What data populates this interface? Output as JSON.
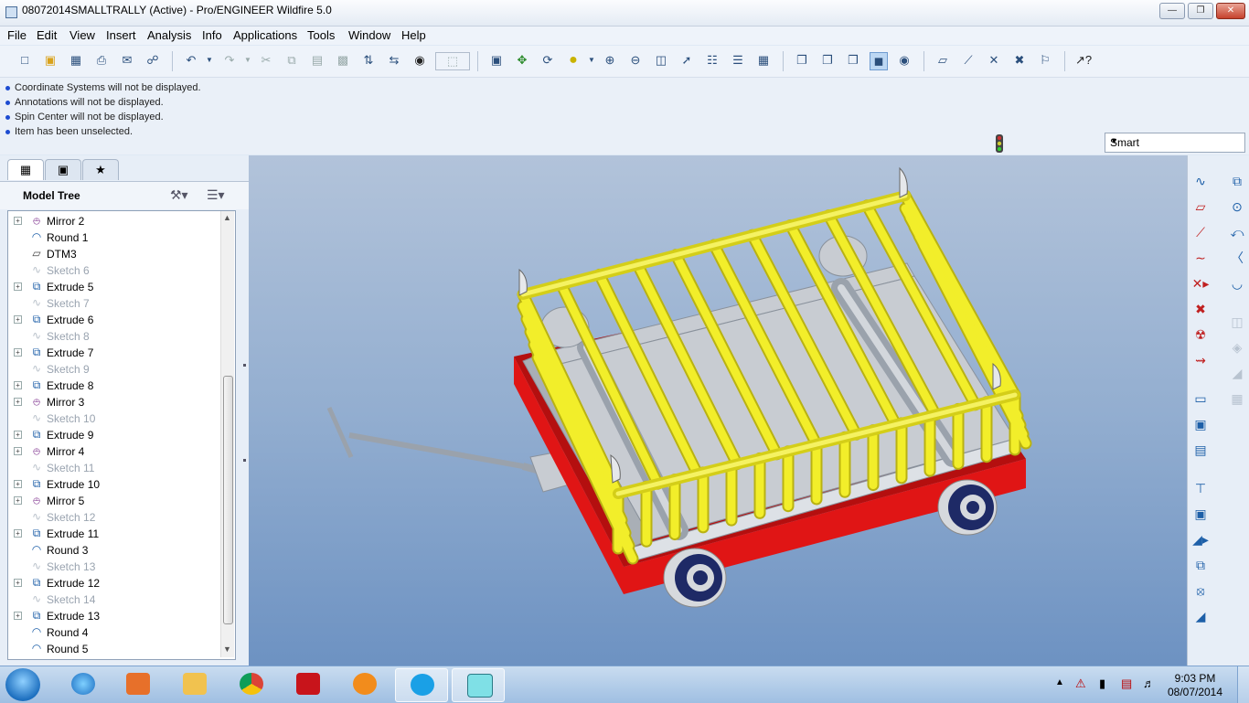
{
  "window": {
    "title": "08072014SMALLTRALLY (Active) - Pro/ENGINEER Wildfire 5.0"
  },
  "menubar": {
    "items": [
      "File",
      "Edit",
      "View",
      "Insert",
      "Analysis",
      "Info",
      "Applications",
      "Tools",
      "Window",
      "Help"
    ]
  },
  "messages": [
    "Coordinate Systems will not be displayed.",
    "Annotations will not be displayed.",
    "Spin Center will not be displayed.",
    "Item has been unselected."
  ],
  "filter": {
    "value": "Smart"
  },
  "model_tree": {
    "title": "Model Tree",
    "items": [
      {
        "label": "Mirror 2",
        "icon": "mirror-icon",
        "expandable": true,
        "sketch": false
      },
      {
        "label": "Round 1",
        "icon": "round-icon",
        "expandable": false,
        "sketch": false
      },
      {
        "label": "DTM3",
        "icon": "datum-plane-icon",
        "expandable": false,
        "sketch": false
      },
      {
        "label": "Sketch 6",
        "icon": "sketch-icon",
        "expandable": false,
        "sketch": true
      },
      {
        "label": "Extrude 5",
        "icon": "extrude-icon",
        "expandable": true,
        "sketch": false
      },
      {
        "label": "Sketch 7",
        "icon": "sketch-icon",
        "expandable": false,
        "sketch": true
      },
      {
        "label": "Extrude 6",
        "icon": "extrude-icon",
        "expandable": true,
        "sketch": false
      },
      {
        "label": "Sketch 8",
        "icon": "sketch-icon",
        "expandable": false,
        "sketch": true
      },
      {
        "label": "Extrude 7",
        "icon": "extrude-icon",
        "expandable": true,
        "sketch": false
      },
      {
        "label": "Sketch 9",
        "icon": "sketch-icon",
        "expandable": false,
        "sketch": true
      },
      {
        "label": "Extrude 8",
        "icon": "extrude-icon",
        "expandable": true,
        "sketch": false
      },
      {
        "label": "Mirror 3",
        "icon": "mirror-icon",
        "expandable": true,
        "sketch": false
      },
      {
        "label": "Sketch 10",
        "icon": "sketch-icon",
        "expandable": false,
        "sketch": true
      },
      {
        "label": "Extrude 9",
        "icon": "extrude-icon",
        "expandable": true,
        "sketch": false
      },
      {
        "label": "Mirror 4",
        "icon": "mirror-icon",
        "expandable": true,
        "sketch": false
      },
      {
        "label": "Sketch 11",
        "icon": "sketch-icon",
        "expandable": false,
        "sketch": true
      },
      {
        "label": "Extrude 10",
        "icon": "extrude-icon",
        "expandable": true,
        "sketch": false
      },
      {
        "label": "Mirror 5",
        "icon": "mirror-icon",
        "expandable": true,
        "sketch": false
      },
      {
        "label": "Sketch 12",
        "icon": "sketch-icon",
        "expandable": false,
        "sketch": true
      },
      {
        "label": "Extrude 11",
        "icon": "extrude-icon",
        "expandable": true,
        "sketch": false
      },
      {
        "label": "Round 3",
        "icon": "round-icon",
        "expandable": false,
        "sketch": false
      },
      {
        "label": "Sketch 13",
        "icon": "sketch-icon",
        "expandable": false,
        "sketch": true
      },
      {
        "label": "Extrude 12",
        "icon": "extrude-icon",
        "expandable": true,
        "sketch": false
      },
      {
        "label": "Sketch 14",
        "icon": "sketch-icon",
        "expandable": false,
        "sketch": true
      },
      {
        "label": "Extrude 13",
        "icon": "extrude-icon",
        "expandable": true,
        "sketch": false
      },
      {
        "label": "Round 4",
        "icon": "round-icon",
        "expandable": false,
        "sketch": false
      },
      {
        "label": "Round 5",
        "icon": "round-icon",
        "expandable": false,
        "sketch": false
      }
    ]
  },
  "colors": {
    "cart_yellow": "#f2ee2a",
    "cart_red": "#e01515",
    "cart_gray": "#c8ccd2",
    "viewport_top": "#b2c3da",
    "viewport_bottom": "#6d92c2"
  },
  "taskbar": {
    "time": "9:03 PM",
    "date": "08/07/2014"
  }
}
